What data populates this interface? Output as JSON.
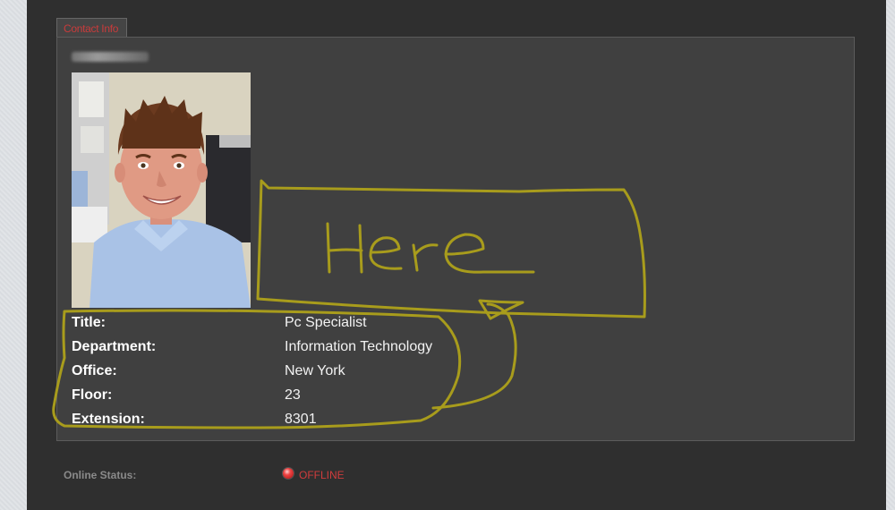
{
  "tab": {
    "label": "Contact Info"
  },
  "contact": {
    "fields": [
      {
        "label": "Title:",
        "value": "Pc Specialist"
      },
      {
        "label": "Department:",
        "value": "Information Technology"
      },
      {
        "label": "Office:",
        "value": "New York"
      },
      {
        "label": "Floor:",
        "value": "23"
      },
      {
        "label": "Extension:",
        "value": "8301"
      }
    ]
  },
  "status": {
    "label": "Online Status:",
    "value": "OFFLINE",
    "icon": "offline-status-icon"
  },
  "annotation": {
    "text": "Here",
    "color": "#a89c1c"
  },
  "colors": {
    "accent": "#c93b3b",
    "panel": "#404040",
    "background": "#2f2f2f"
  }
}
